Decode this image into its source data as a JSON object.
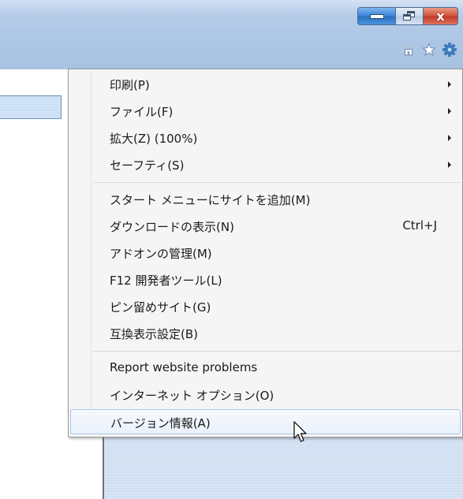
{
  "window": {
    "controls": {
      "minimize_icon": "minimize-icon",
      "restore_icon": "restore-icon",
      "close_icon": "close-icon",
      "close_glyph": "x"
    }
  },
  "toolbar": {
    "icons": [
      "home-icon",
      "favorites-star-icon",
      "tools-gear-icon"
    ]
  },
  "menu": {
    "groups": [
      {
        "items": [
          {
            "label": "印刷(P)",
            "submenu": true
          },
          {
            "label": "ファイル(F)",
            "submenu": true
          },
          {
            "label": "拡大(Z) (100%)",
            "submenu": true
          },
          {
            "label": "セーフティ(S)",
            "submenu": true
          }
        ]
      },
      {
        "items": [
          {
            "label": "スタート メニューにサイトを追加(M)"
          },
          {
            "label": "ダウンロードの表示(N)",
            "shortcut": "Ctrl+J"
          },
          {
            "label": "アドオンの管理(M)"
          },
          {
            "label": "F12 開発者ツール(L)"
          },
          {
            "label": "ピン留めサイト(G)"
          },
          {
            "label": "互換表示設定(B)"
          }
        ]
      },
      {
        "items": [
          {
            "label": "Report website problems"
          },
          {
            "label": "インターネット オプション(O)"
          },
          {
            "label": "バージョン情報(A)",
            "highlighted": true
          }
        ]
      }
    ]
  },
  "colors": {
    "titlebar": "#afc8e6",
    "menu_bg": "#f5f5f5",
    "highlight_border": "#aac6e8",
    "close_red": "#c0392b",
    "minimize_blue": "#2a6fc0"
  }
}
